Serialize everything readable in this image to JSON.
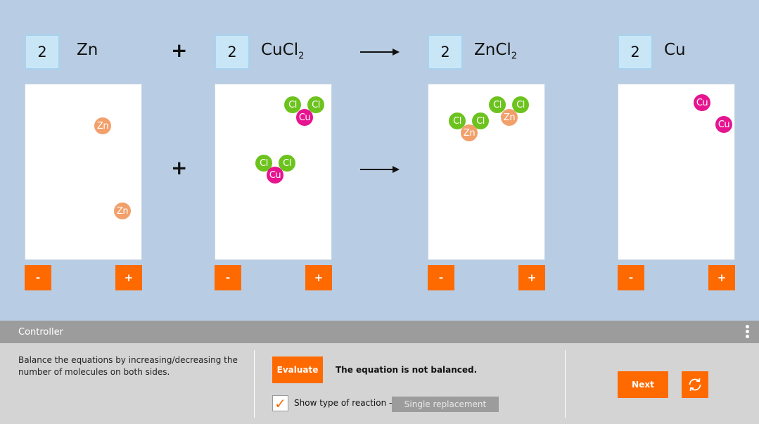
{
  "equation": {
    "terms": [
      {
        "coefficient": "2",
        "formula": "Zn",
        "sub": ""
      },
      {
        "coefficient": "2",
        "formula": "CuCl",
        "sub": "2"
      },
      {
        "coefficient": "2",
        "formula": "ZnCl",
        "sub": "2"
      },
      {
        "coefficient": "2",
        "formula": "Cu",
        "sub": ""
      }
    ],
    "plus_symbol": "+",
    "arrow_icon": "right-arrow-icon"
  },
  "stepper": {
    "minus_label": "-",
    "plus_label": "+"
  },
  "atoms": {
    "zn": "Zn",
    "cl": "Cl",
    "cu": "Cu"
  },
  "colors": {
    "zn": "#f2a06b",
    "cl": "#6cc31d",
    "cu": "#e6148f",
    "accent": "#ff6a00",
    "stage_bg": "#b8cde3"
  },
  "controller": {
    "title": "Controller",
    "menu_icon": "kebab-menu-icon",
    "instructions": "Balance the equations by increasing/decreasing the number of molecules on both sides.",
    "evaluate_label": "Evaluate",
    "result_text": "The equation is not balanced.",
    "show_type": {
      "checked": true,
      "check_icon": "checkmark-icon",
      "label": "Show type of reaction -",
      "value": "Single replacement"
    },
    "next_label": "Next",
    "reset_icon": "refresh-icon"
  }
}
